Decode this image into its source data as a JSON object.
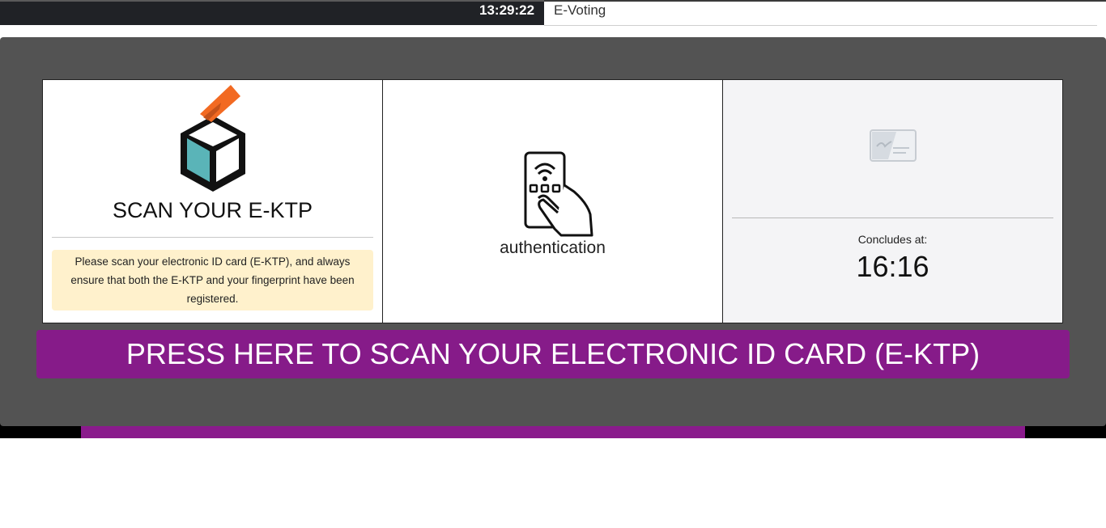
{
  "header": {
    "clock": "13:29:22",
    "app_title": "E-Voting"
  },
  "cards": {
    "scan": {
      "icon": "ballot-box-icon",
      "title": "SCAN YOUR E-KTP",
      "notice": "Please scan your electronic ID card (E-KTP), and always ensure that both the E-KTP and your fingerprint have been registered."
    },
    "auth": {
      "icon": "nfc-card-hand-icon",
      "label": "authentication"
    },
    "status": {
      "icon": "id-card-icon",
      "concludes_label": "Concludes at:",
      "concludes_time": "16:16"
    }
  },
  "scan_button": {
    "label": "PRESS HERE TO SCAN YOUR ELECTRONIC ID CARD (E-KTP)"
  },
  "colors": {
    "accent_purple": "#861b89",
    "panel_grey": "#535353",
    "notice_bg": "#fff1cc",
    "ballot_orange": "#f26a22",
    "ballot_teal": "#5ab4b8"
  }
}
